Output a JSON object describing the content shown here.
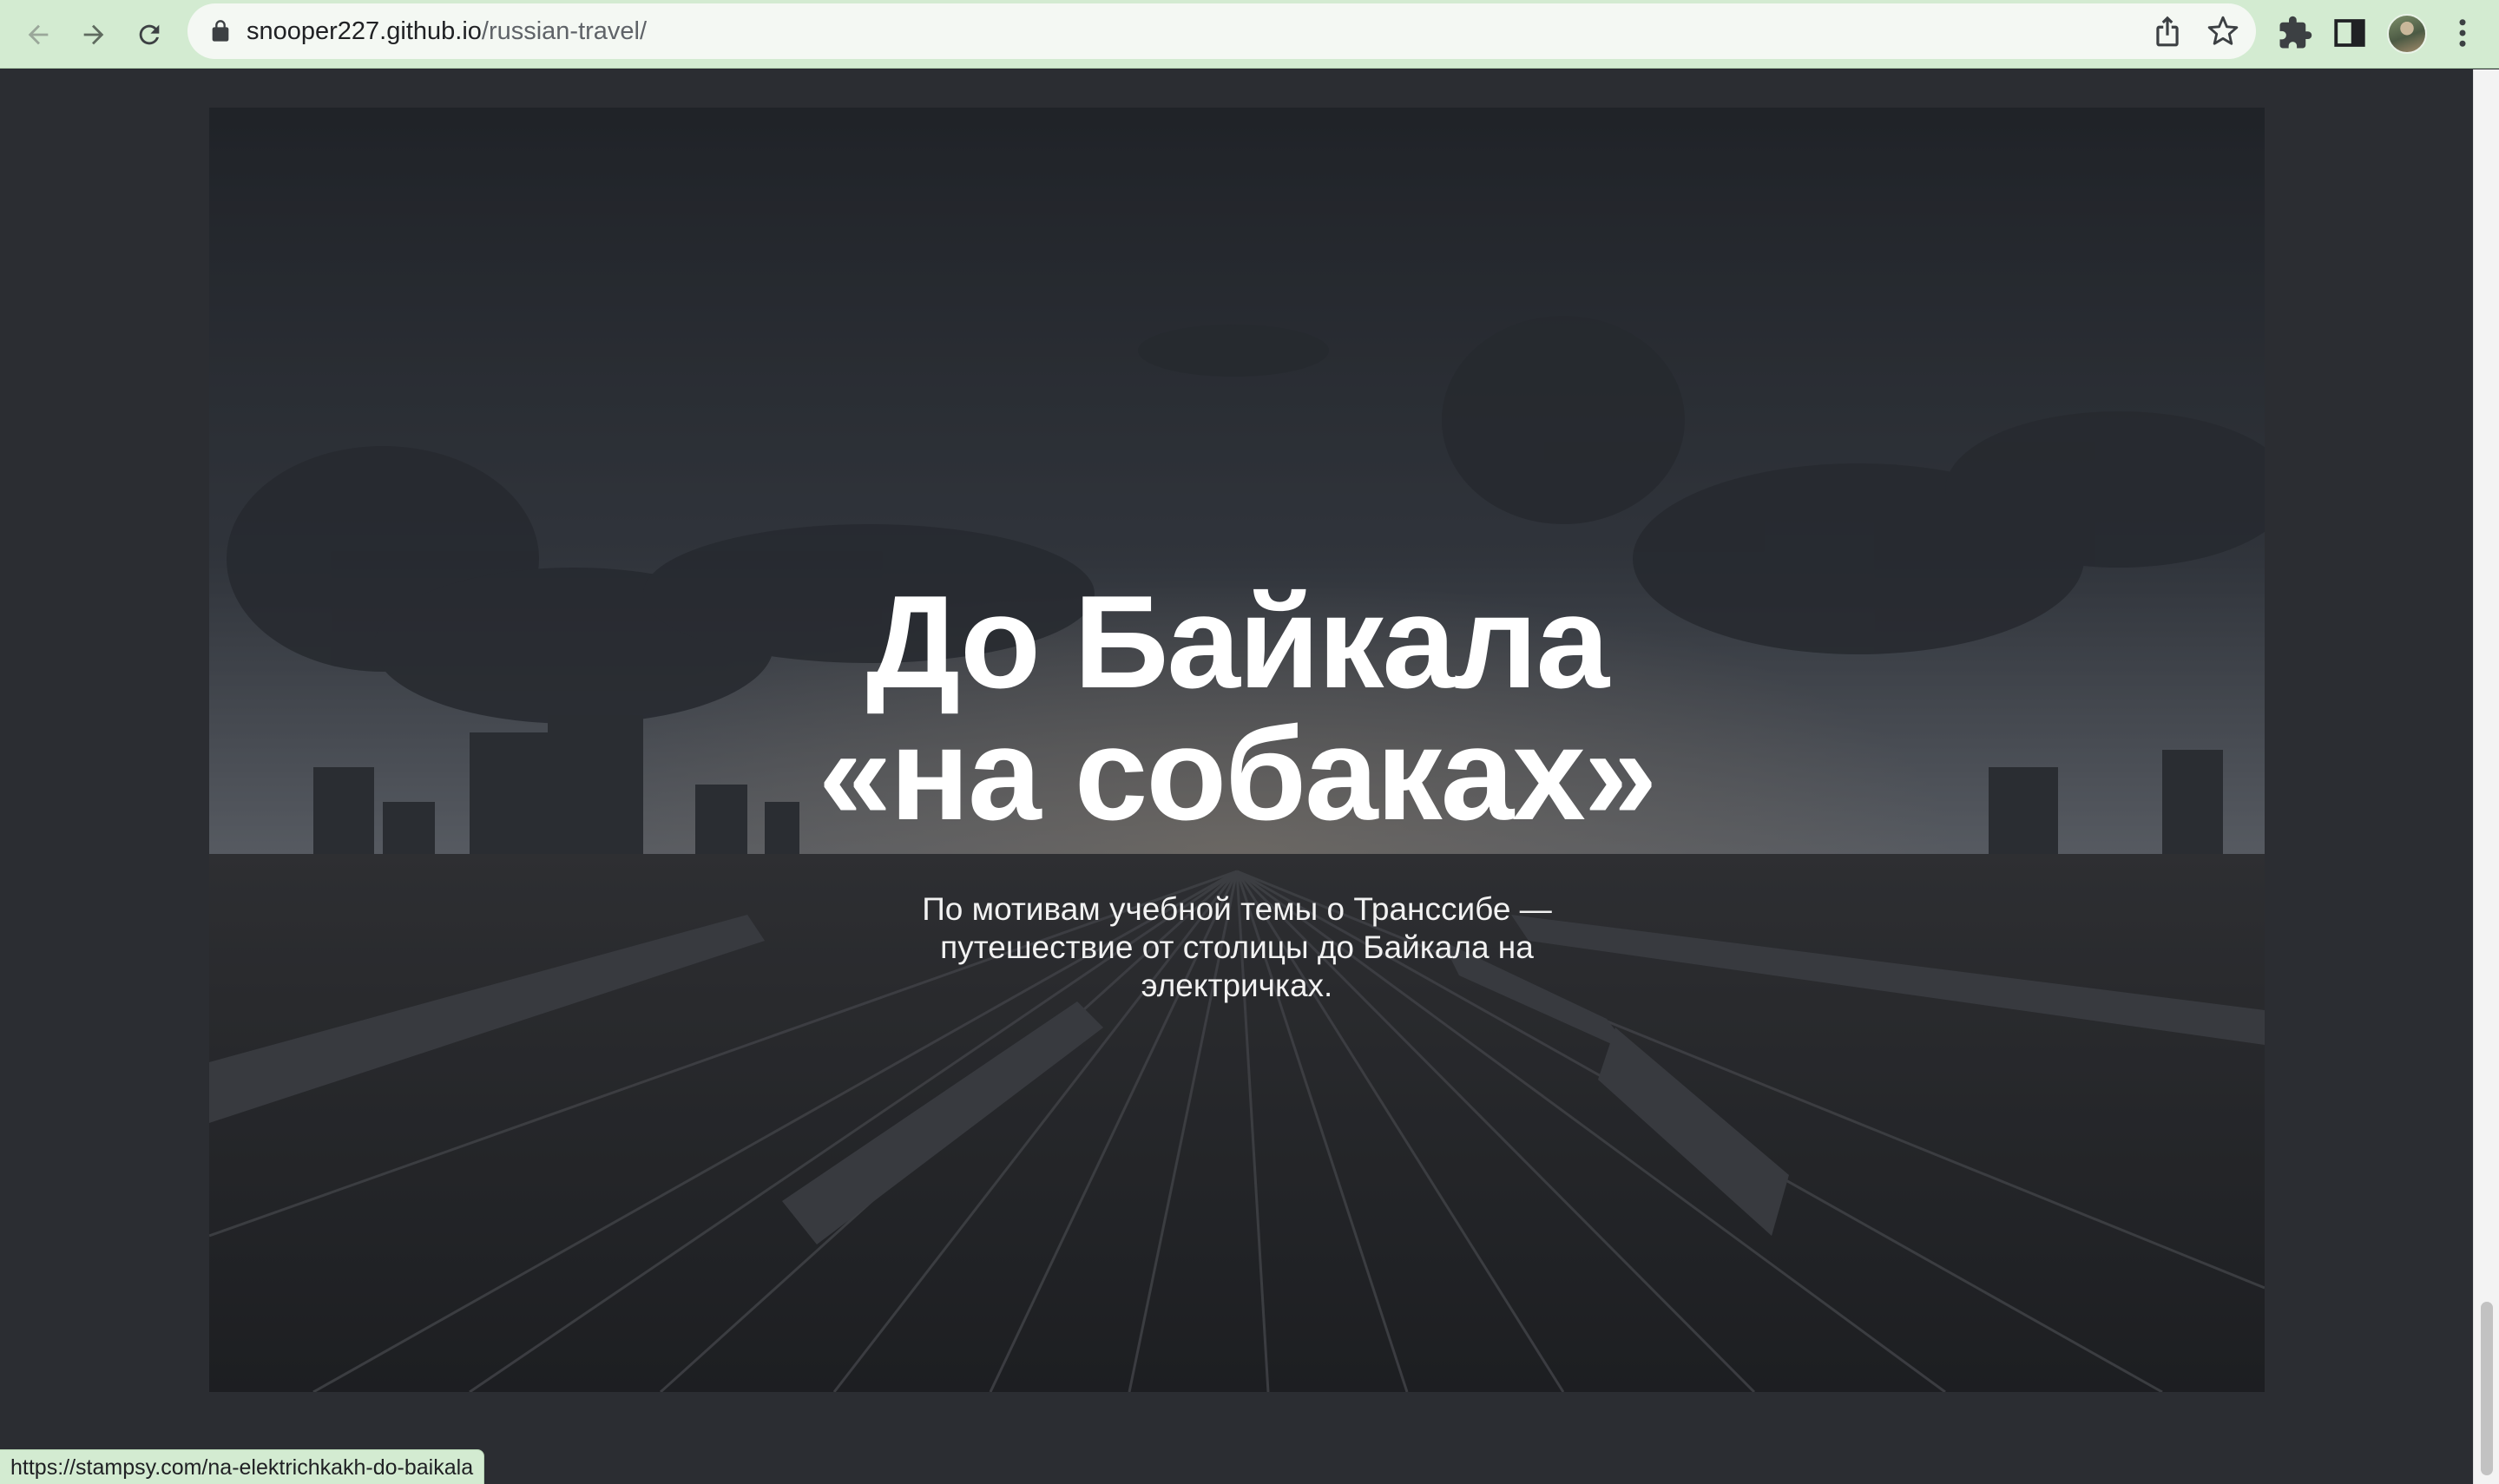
{
  "browser": {
    "url_host": "snooper227.github.io",
    "url_path": "/russian-travel/",
    "status_url": "https://stampsy.com/na-elektrichkakh-do-baikala",
    "icons": {
      "back": "arrow-left-icon",
      "forward": "arrow-right-icon",
      "reload": "reload-icon",
      "lock": "lock-icon",
      "share": "share-icon",
      "bookmark": "star-icon",
      "extensions": "puzzle-icon",
      "side_panel": "side-panel-icon",
      "menu": "kebab-menu-icon"
    }
  },
  "hero": {
    "title_line1": "До Байкала",
    "title_line2": "«на собаках»",
    "subtitle": "По мотивам учебной темы о Транссибе — путешествие от столицы до Байкала на электричках."
  },
  "colors": {
    "chrome": "#d3ebd1",
    "page_bg": "#2b2d32",
    "text": "#ffffff"
  }
}
